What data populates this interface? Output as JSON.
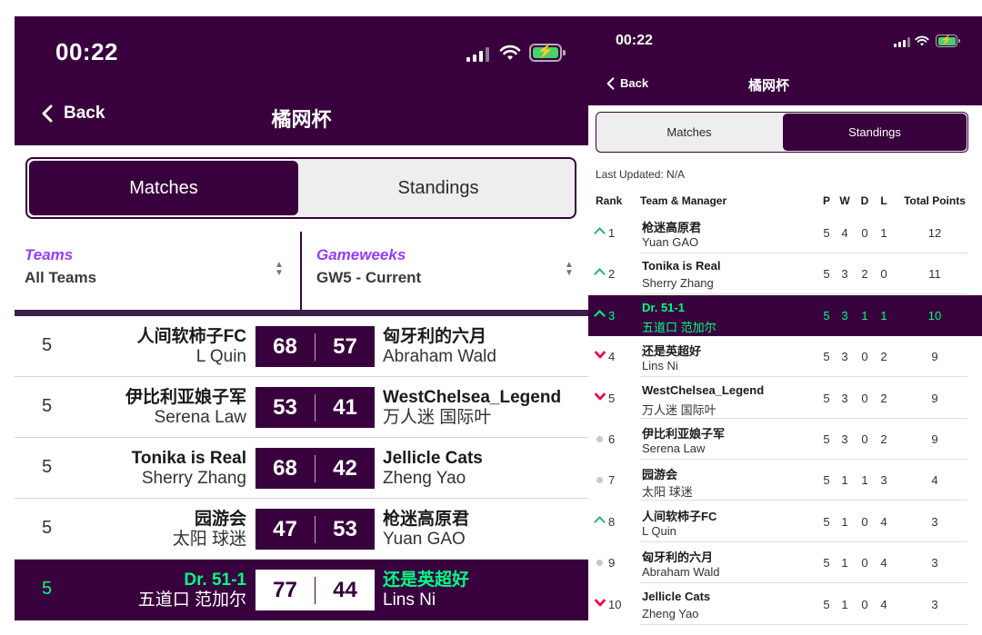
{
  "left": {
    "status_time": "00:22",
    "back_label": "Back",
    "title": "橘网杯",
    "tabs": {
      "matches": "Matches",
      "standings": "Standings",
      "active": "Matches"
    },
    "filters": {
      "teams_label": "Teams",
      "teams_value": "All Teams",
      "gameweeks_label": "Gameweeks",
      "gameweeks_value": "GW5 - Current"
    },
    "matches": [
      {
        "gw": "5",
        "home_team": "人间软柿子FC",
        "home_manager": "L Quin",
        "home_score": "68",
        "away_score": "57",
        "away_team": "匈牙利的六月",
        "away_manager": "Abraham Wald",
        "highlighted": false
      },
      {
        "gw": "5",
        "home_team": "伊比利亚娘子军",
        "home_manager": "Serena Law",
        "home_score": "53",
        "away_score": "41",
        "away_team": "WestChelsea_Legend",
        "away_manager": "万人迷 国际叶",
        "highlighted": false
      },
      {
        "gw": "5",
        "home_team": "Tonika is Real",
        "home_manager": "Sherry Zhang",
        "home_score": "68",
        "away_score": "42",
        "away_team": "Jellicle Cats",
        "away_manager": "Zheng Yao",
        "highlighted": false
      },
      {
        "gw": "5",
        "home_team": "园游会",
        "home_manager": "太阳 球迷",
        "home_score": "47",
        "away_score": "53",
        "away_team": "枪迷高原君",
        "away_manager": "Yuan GAO",
        "highlighted": false
      },
      {
        "gw": "5",
        "home_team": "Dr. 51-1",
        "home_manager": "五道口 范加尔",
        "home_score": "77",
        "away_score": "44",
        "away_team": "还是英超好",
        "away_manager": "Lins Ni",
        "highlighted": true
      }
    ]
  },
  "right": {
    "status_time": "00:22",
    "back_label": "Back",
    "title": "橘网杯",
    "tabs": {
      "matches": "Matches",
      "standings": "Standings",
      "active": "Standings"
    },
    "last_updated": "Last Updated: N/A",
    "columns": {
      "rank": "Rank",
      "team": "Team & Manager",
      "p": "P",
      "w": "W",
      "d": "D",
      "l": "L",
      "total": "Total Points"
    },
    "standings": [
      {
        "rank": "1",
        "movement": "up",
        "team": "枪迷高原君",
        "manager": "Yuan GAO",
        "p": "5",
        "w": "4",
        "d": "0",
        "l": "1",
        "total": "12",
        "highlighted": false
      },
      {
        "rank": "2",
        "movement": "up",
        "team": "Tonika is Real",
        "manager": "Sherry Zhang",
        "p": "5",
        "w": "3",
        "d": "2",
        "l": "0",
        "total": "11",
        "highlighted": false
      },
      {
        "rank": "3",
        "movement": "up",
        "team": "Dr. 51-1",
        "manager": "五道口 范加尔",
        "p": "5",
        "w": "3",
        "d": "1",
        "l": "1",
        "total": "10",
        "highlighted": true
      },
      {
        "rank": "4",
        "movement": "down",
        "team": "还是英超好",
        "manager": "Lins Ni",
        "p": "5",
        "w": "3",
        "d": "0",
        "l": "2",
        "total": "9",
        "highlighted": false
      },
      {
        "rank": "5",
        "movement": "down",
        "team": "WestChelsea_Legend",
        "manager": "万人迷 国际叶",
        "p": "5",
        "w": "3",
        "d": "0",
        "l": "2",
        "total": "9",
        "highlighted": false
      },
      {
        "rank": "6",
        "movement": "same",
        "team": "伊比利亚娘子军",
        "manager": "Serena Law",
        "p": "5",
        "w": "3",
        "d": "0",
        "l": "2",
        "total": "9",
        "highlighted": false
      },
      {
        "rank": "7",
        "movement": "same",
        "team": "园游会",
        "manager": "太阳 球迷",
        "p": "5",
        "w": "1",
        "d": "1",
        "l": "3",
        "total": "4",
        "highlighted": false
      },
      {
        "rank": "8",
        "movement": "up",
        "team": "人间软柿子FC",
        "manager": "L Quin",
        "p": "5",
        "w": "1",
        "d": "0",
        "l": "4",
        "total": "3",
        "highlighted": false
      },
      {
        "rank": "9",
        "movement": "same",
        "team": "匈牙利的六月",
        "manager": "Abraham Wald",
        "p": "5",
        "w": "1",
        "d": "0",
        "l": "4",
        "total": "3",
        "highlighted": false
      },
      {
        "rank": "10",
        "movement": "down",
        "team": "Jellicle Cats",
        "manager": "Zheng Yao",
        "p": "5",
        "w": "1",
        "d": "0",
        "l": "4",
        "total": "3",
        "highlighted": false
      }
    ]
  },
  "icons": {
    "signal": "signal-icon",
    "wifi": "wifi-icon",
    "battery": "battery-charging-icon",
    "back": "chevron-left-icon",
    "sort": "sort-arrows-icon",
    "up": "arrow-up-icon",
    "down": "arrow-down-icon",
    "same": "no-change-dot-icon"
  },
  "colors": {
    "brand_purple": "#38003c",
    "accent_green": "#00ff85",
    "label_purple": "#963cff",
    "up_green": "#28b46e",
    "down_red": "#e90052",
    "battery_green": "#47d16c"
  }
}
